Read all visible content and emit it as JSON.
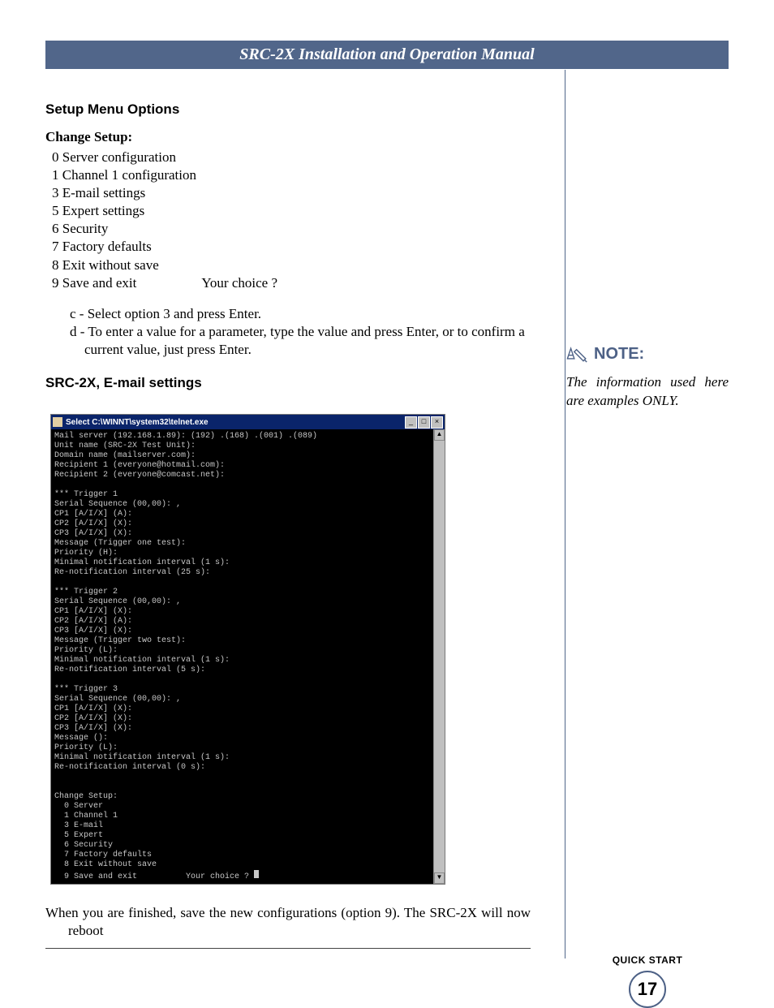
{
  "header": {
    "title": "SRC-2X Installation and Operation Manual"
  },
  "setup": {
    "heading": "Setup Menu Options",
    "label": "Change Setup:",
    "items": [
      "0 Server configuration",
      "1 Channel 1 configuration",
      "3 E-mail settings",
      "5 Expert settings",
      "6 Security",
      "7 Factory defaults",
      "8 Exit without save",
      "9 Save and exit"
    ],
    "prompt": "Your choice ?"
  },
  "steps": {
    "c": "c - Select option 3 and press Enter.",
    "d": "d - To enter a value for a parameter, type the value and press Enter, or to confirm a current value, just press Enter."
  },
  "email_heading": "SRC-2X, E-mail settings",
  "terminal": {
    "title": "Select C:\\WINNT\\system32\\telnet.exe",
    "min": "_",
    "max": "□",
    "close": "×",
    "scroll_up": "▲",
    "scroll_down": "▼",
    "body": "Mail server (192.168.1.89): (192) .(168) .(001) .(089)\nUnit name (SRC-2X Test Unit):\nDomain name (mailserver.com):\nRecipient 1 (everyone@hotmail.com):\nRecipient 2 (everyone@comcast.net):\n\n*** Trigger 1\nSerial Sequence (00,00): ,\nCP1 [A/I/X] (A):\nCP2 [A/I/X] (X):\nCP3 [A/I/X] (X):\nMessage (Trigger one test):\nPriority (H):\nMinimal notification interval (1 s):\nRe-notification interval (25 s):\n\n*** Trigger 2\nSerial Sequence (00,00): ,\nCP1 [A/I/X] (X):\nCP2 [A/I/X] (A):\nCP3 [A/I/X] (X):\nMessage (Trigger two test):\nPriority (L):\nMinimal notification interval (1 s):\nRe-notification interval (5 s):\n\n*** Trigger 3\nSerial Sequence (00,00): ,\nCP1 [A/I/X] (X):\nCP2 [A/I/X] (X):\nCP3 [A/I/X] (X):\nMessage ():\nPriority (L):\nMinimal notification interval (1 s):\nRe-notification interval (0 s):\n\n\nChange Setup:\n  0 Server\n  1 Channel 1\n  3 E-mail\n  5 Expert\n  6 Security\n  7 Factory defaults\n  8 Exit without save\n  9 Save and exit          Your choice ? "
  },
  "finish": "When you are finished, save the new configurations (option 9). The SRC-2X will now reboot",
  "note": {
    "label": "NOTE:",
    "body": "The information used here are examples ONLY."
  },
  "footer": {
    "section": "QUICK START",
    "page": "17"
  }
}
